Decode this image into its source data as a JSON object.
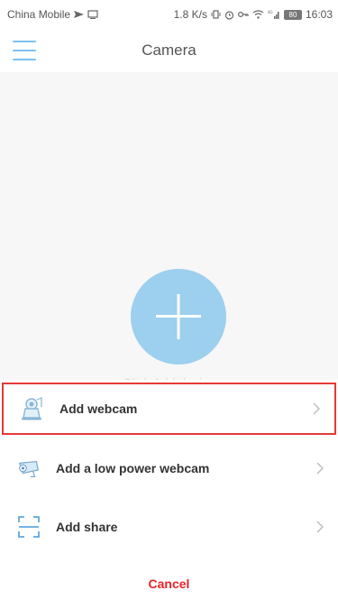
{
  "status_bar": {
    "carrier": "China Mobile",
    "speed": "1.8 K/s",
    "network": "4G",
    "battery": "80",
    "time": "16:03"
  },
  "header": {
    "title": "Camera",
    "menu_icon": "hamburger-menu-icon"
  },
  "main": {
    "add_device_label": "Click Add device",
    "fab_icon": "plus-icon"
  },
  "sheet": {
    "items": [
      {
        "label": "Add webcam",
        "icon": "webcam-icon",
        "selected": true
      },
      {
        "label": "Add a low power webcam",
        "icon": "low-power-webcam-icon",
        "selected": false
      },
      {
        "label": "Add share",
        "icon": "scan-share-icon",
        "selected": false
      }
    ],
    "cancel_label": "Cancel"
  },
  "colors": {
    "accent": "#7cbfe9",
    "cancel": "#e8242a",
    "selection_border": "#e53935"
  }
}
